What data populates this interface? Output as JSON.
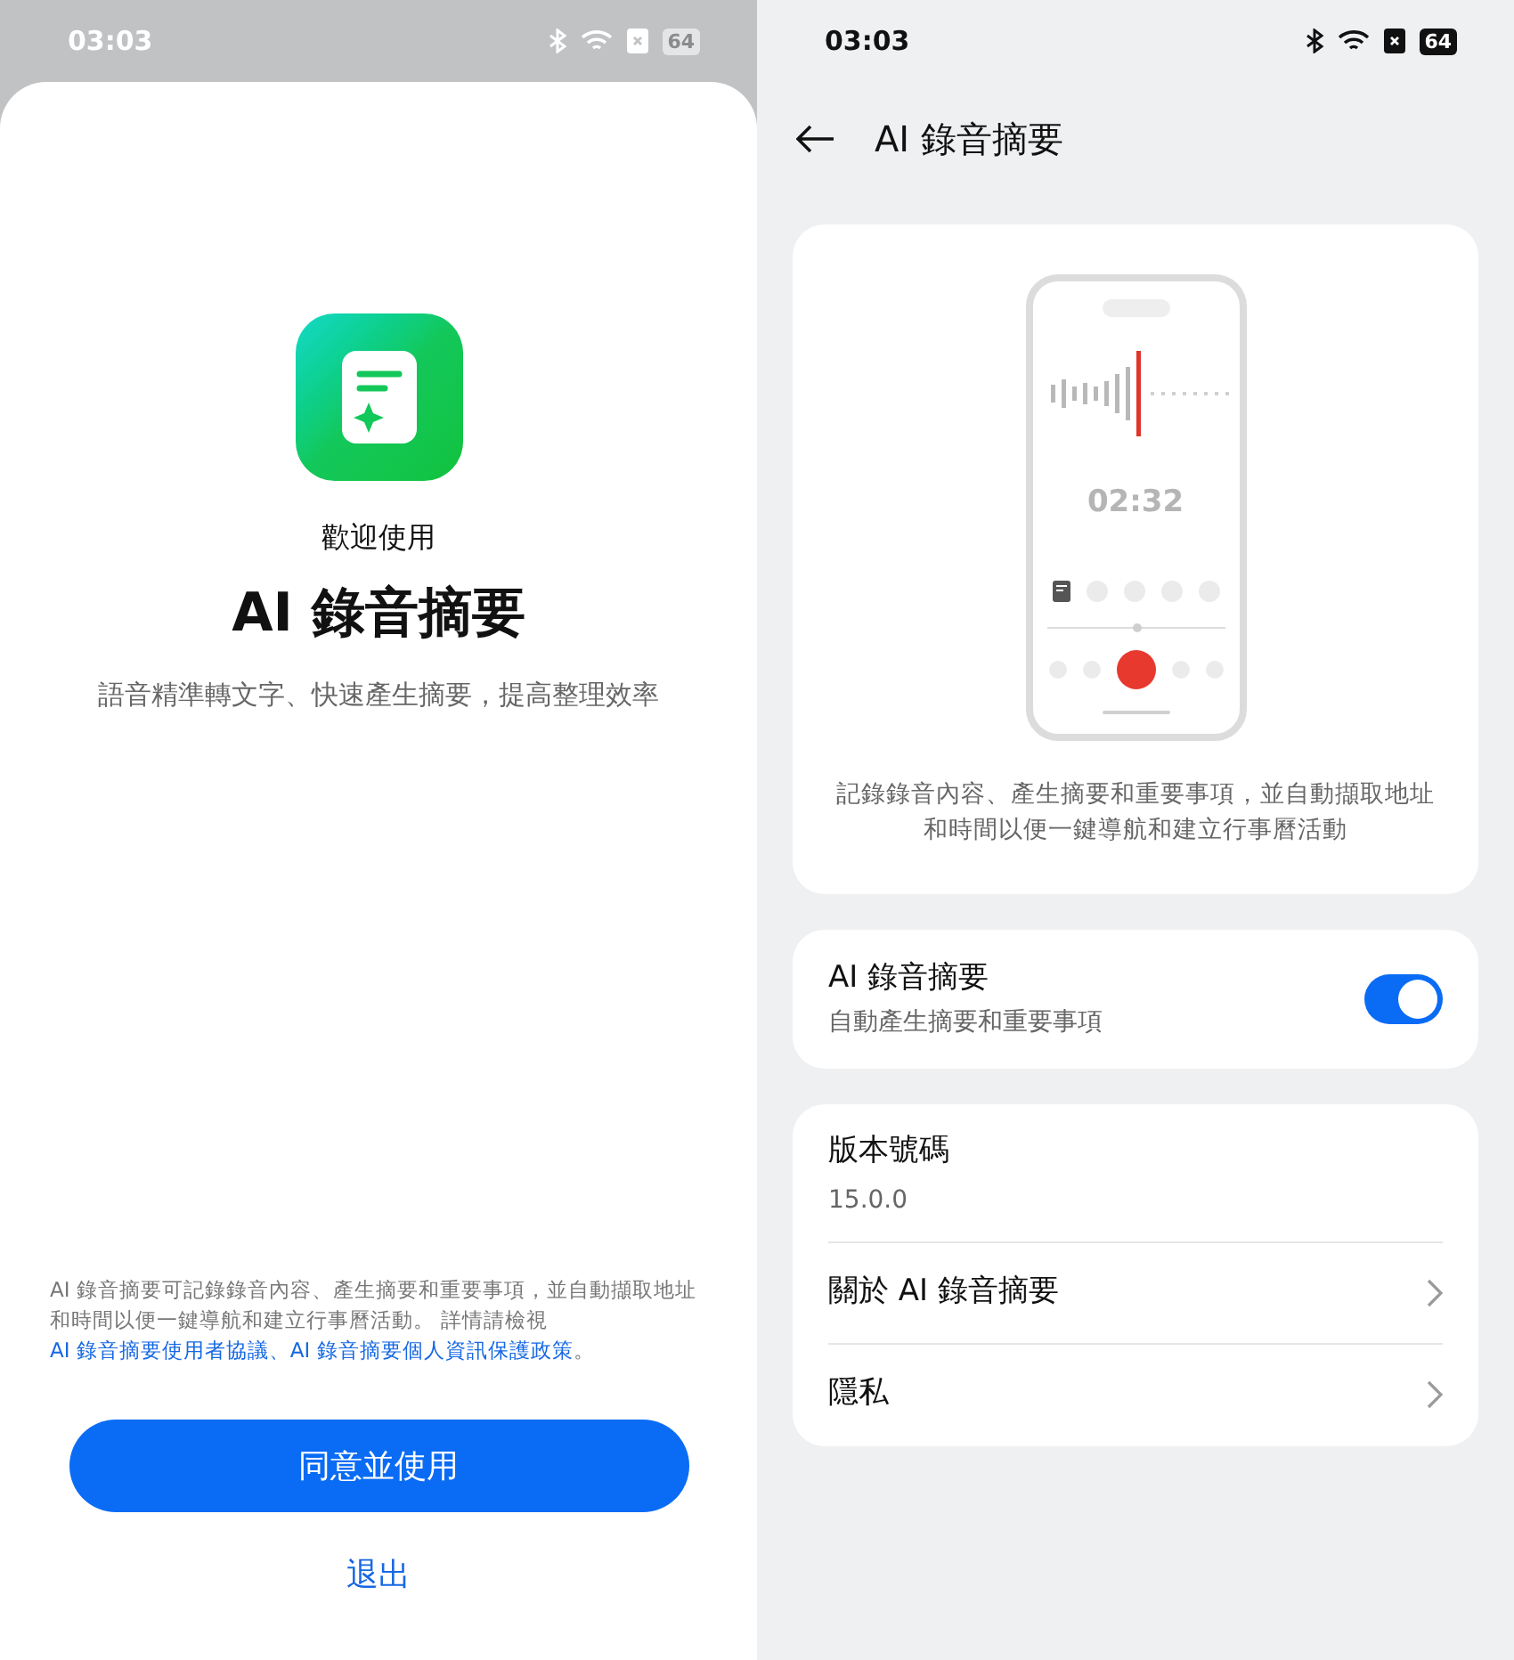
{
  "left_screen": {
    "status_bar": {
      "time": "03:03",
      "battery": "64"
    },
    "welcome": {
      "subtitle": "歡迎使用",
      "title": "AI 錄音摘要",
      "tagline": "語音精準轉文字、快速產生摘要，提高整理效率"
    },
    "disclaimer": [
      {
        "kind": "text",
        "text": "AI 錄音摘要可記錄錄音內容、產生摘要和重要事項，並自動擷取地址和時間以便一鍵導航和建立行事曆活動。 詳情請檢視 "
      },
      {
        "kind": "link",
        "text": "AI 錄音摘要使用者協議"
      },
      {
        "kind": "link",
        "text": "、"
      },
      {
        "kind": "link",
        "text": "AI 錄音摘要個人資訊保護政策"
      },
      {
        "kind": "text",
        "text": "。"
      }
    ],
    "agree_button": "同意並使用",
    "exit_link": "退出"
  },
  "right_screen": {
    "status_bar": {
      "time": "03:03",
      "battery": "64"
    },
    "header": {
      "title": "AI 錄音摘要"
    },
    "preview": {
      "timer": "02:32",
      "description": "記錄錄音內容、產生摘要和重要事項，並自動擷取地址和時間以便一鍵導航和建立行事曆活動"
    },
    "toggle_row": {
      "title": "AI 錄音摘要",
      "subtitle": "自動產生摘要和重要事項",
      "on": true
    },
    "info": {
      "version_label": "版本號碼",
      "version": "15.0.0",
      "items": [
        {
          "label": "關於 AI 錄音摘要"
        },
        {
          "label": "隱私"
        }
      ]
    }
  }
}
